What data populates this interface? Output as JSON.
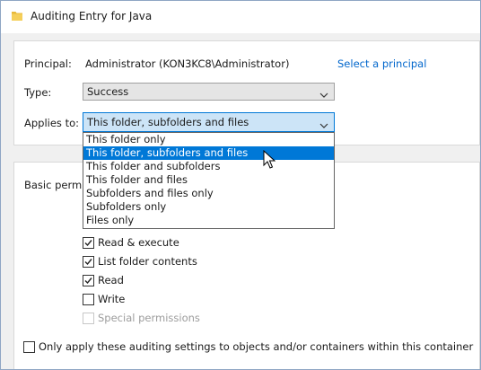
{
  "window": {
    "title": "Auditing Entry for Java"
  },
  "principal": {
    "label": "Principal:",
    "value": "Administrator (KON3KC8\\Administrator)",
    "select_link": "Select a principal"
  },
  "type": {
    "label": "Type:",
    "value": "Success"
  },
  "applies_to": {
    "label": "Applies to:",
    "value": "This folder, subfolders and files",
    "options": [
      "This folder only",
      "This folder, subfolders and files",
      "This folder and subfolders",
      "This folder and files",
      "Subfolders and files only",
      "Subfolders only",
      "Files only"
    ],
    "selected_index": 1
  },
  "permissions": {
    "heading": "Basic permis",
    "items": [
      {
        "label": "Read & execute",
        "checked": true,
        "enabled": true
      },
      {
        "label": "List folder contents",
        "checked": true,
        "enabled": true
      },
      {
        "label": "Read",
        "checked": true,
        "enabled": true
      },
      {
        "label": "Write",
        "checked": false,
        "enabled": true
      },
      {
        "label": "Special permissions",
        "checked": false,
        "enabled": false
      }
    ]
  },
  "only_apply": {
    "label": "Only apply these auditing settings to objects and/or containers within this container",
    "checked": false
  },
  "colors": {
    "accent": "#0078d7",
    "link": "#0066cc",
    "combo_focus": "#cce4f7"
  }
}
